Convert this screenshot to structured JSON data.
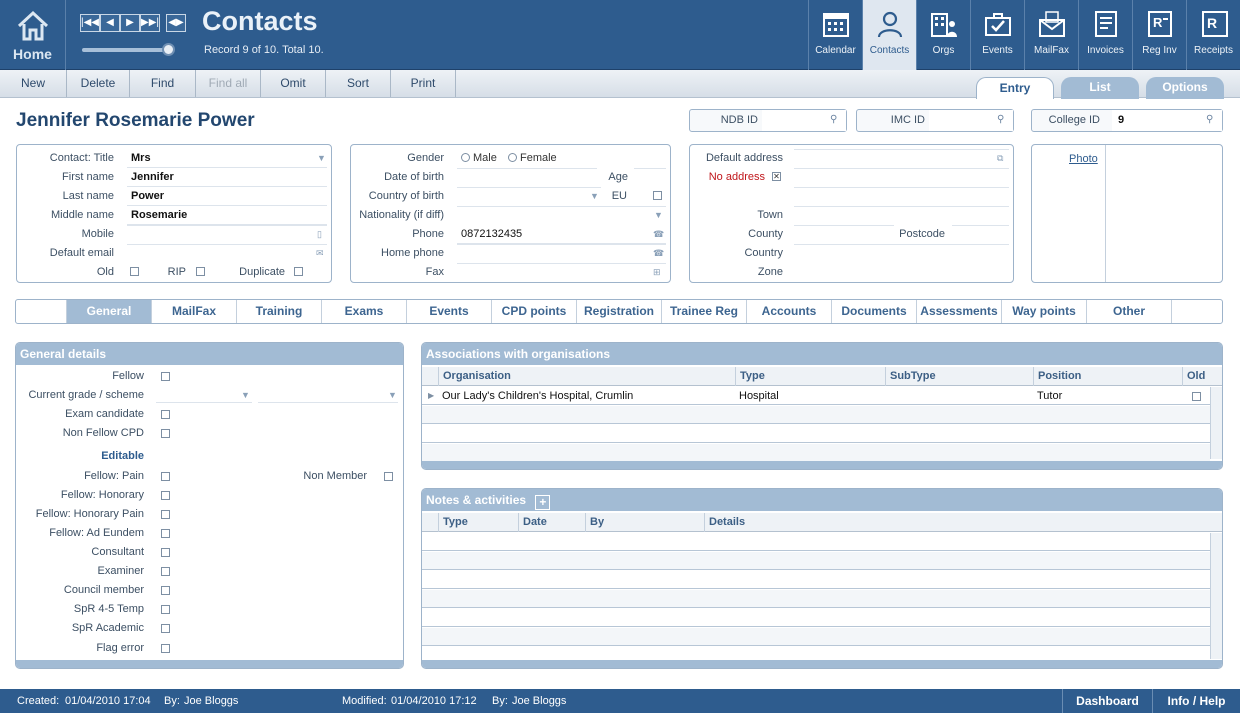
{
  "app": {
    "home_label": "Home",
    "title": "Contacts",
    "record_status": "Record 9 of 10. Total 10.",
    "modules": [
      "Calendar",
      "Contacts",
      "Orgs",
      "Events",
      "MailFax",
      "Invoices",
      "Reg Inv",
      "Receipts"
    ],
    "active_module": "Contacts",
    "nav_buttons": [
      "|◀◀",
      "◀",
      "▶",
      "▶▶|",
      "◀▶"
    ]
  },
  "toolbar": {
    "new": "New",
    "delete": "Delete",
    "find": "Find",
    "find_all": "Find all",
    "omit": "Omit",
    "sort": "Sort",
    "print": "Print"
  },
  "view_tabs": {
    "entry": "Entry",
    "list": "List",
    "options": "Options"
  },
  "person": {
    "full_name": "Jennifer Rosemarie Power"
  },
  "ids": {
    "ndb_label": "NDB ID",
    "ndb_value": "",
    "imc_label": "IMC ID",
    "imc_value": "",
    "college_label": "College ID",
    "college_value": "9"
  },
  "contact": {
    "title_label": "Contact: Title",
    "title_value": "Mrs",
    "first_label": "First name",
    "first_value": "Jennifer",
    "last_label": "Last name",
    "last_value": "Power",
    "middle_label": "Middle name",
    "middle_value": "Rosemarie",
    "mobile_label": "Mobile",
    "mobile_value": "",
    "email_label": "Default email",
    "email_value": "",
    "old_label": "Old",
    "rip_label": "RIP",
    "duplicate_label": "Duplicate"
  },
  "personal": {
    "gender_label": "Gender",
    "male": "Male",
    "female": "Female",
    "dob_label": "Date of birth",
    "age_label": "Age",
    "cob_label": "Country of birth",
    "eu_label": "EU",
    "nationality_label": "Nationality (if diff)",
    "phone_label": "Phone",
    "phone_value": "0872132435",
    "homephone_label": "Home phone",
    "fax_label": "Fax"
  },
  "address": {
    "default_label": "Default address",
    "no_address_label": "No address",
    "town_label": "Town",
    "county_label": "County",
    "postcode_label": "Postcode",
    "country_label": "Country",
    "zone_label": "Zone"
  },
  "photo_label": "Photo",
  "subtabs": [
    "General",
    "MailFax",
    "Training",
    "Exams",
    "Events",
    "CPD points",
    "Registration",
    "Trainee Reg",
    "Accounts",
    "Documents",
    "Assessments",
    "Way points",
    "Other"
  ],
  "active_subtab": "General",
  "general": {
    "header": "General details",
    "fellow": "Fellow",
    "grade": "Current grade / scheme",
    "exam_candidate": "Exam candidate",
    "non_fellow_cpd": "Non Fellow CPD",
    "editable": "Editable",
    "fellow_pain": "Fellow: Pain",
    "non_member": "Non Member",
    "fellow_honorary": "Fellow: Honorary",
    "fellow_honorary_pain": "Fellow: Honorary Pain",
    "fellow_ad_eundem": "Fellow: Ad Eundem",
    "consultant": "Consultant",
    "examiner": "Examiner",
    "council_member": "Council member",
    "spr_temp": "SpR 4-5 Temp",
    "spr_academic": "SpR Academic",
    "flag_error": "Flag error"
  },
  "associations": {
    "header": "Associations with  organisations",
    "columns": [
      "Organisation",
      "Type",
      "SubType",
      "Position",
      "Old"
    ],
    "rows": [
      {
        "organisation": "Our Lady's Children's Hospital, Crumlin",
        "type": "Hospital",
        "subtype": "",
        "position": "Tutor"
      }
    ]
  },
  "notes": {
    "header": "Notes & activities",
    "columns": [
      "Type",
      "Date",
      "By",
      "Details"
    ]
  },
  "footer": {
    "created_label": "Created:",
    "created_value": "01/04/2010  17:04",
    "created_by_label": "By:",
    "created_by": "Joe Bloggs",
    "modified_label": "Modified:",
    "modified_value": "01/04/2010  17:12",
    "modified_by_label": "By:",
    "modified_by": "Joe Bloggs",
    "dashboard": "Dashboard",
    "info_help": "Info / Help"
  },
  "colors": {
    "brand": "#2e5c8e",
    "panel_header": "#a2bbd4",
    "warning": "#c0161b"
  }
}
